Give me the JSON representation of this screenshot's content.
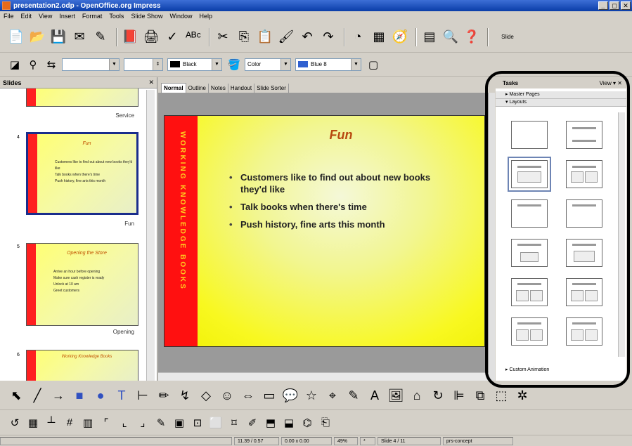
{
  "window": {
    "title": "presentation2.odp - OpenOffice.org Impress"
  },
  "menu": [
    "File",
    "Edit",
    "View",
    "Insert",
    "Format",
    "Tools",
    "Slide Show",
    "Window",
    "Help"
  ],
  "toolbar2": {
    "line_color": "Black",
    "area_style": "Color",
    "area_fill": "Blue 8"
  },
  "toolbar1": {
    "slide_label": "Slide"
  },
  "slides_pane": {
    "title": "Slides",
    "slides": [
      {
        "num": "",
        "name": "Service"
      },
      {
        "num": "4",
        "name": "Fun",
        "title": "Fun",
        "lines": [
          "Customers like to find out about new books they'd like",
          "Talk books when there's time",
          "Push history, fine arts this month"
        ]
      },
      {
        "num": "5",
        "name": "Opening",
        "title": "Opening the Store",
        "lines": [
          "Arrive an hour before opening",
          "Make sure cash register is ready",
          "Unlock at 10 am",
          "Greet customers"
        ]
      },
      {
        "num": "6",
        "name": "",
        "title": "Working Knowledge Books"
      }
    ]
  },
  "view_tabs": [
    "Normal",
    "Outline",
    "Notes",
    "Handout",
    "Slide Sorter"
  ],
  "slide": {
    "title": "Fun",
    "side_text": "WORKING KNOWLEDGE BOOKS",
    "bullets": [
      "Customers like to find out about new books they'd like",
      "Talk books when there's time",
      "Push history, fine arts this month"
    ]
  },
  "tasks_pane": {
    "title": "Tasks",
    "view_label": "View",
    "sections": {
      "master_pages": "Master Pages",
      "layouts": "Layouts",
      "custom_animation": "Custom Animation"
    }
  },
  "status": {
    "position": "11.39 / 0.57",
    "size": "0.00 x 0.00",
    "zoom": "49%",
    "page": "Slide 4 / 11",
    "master": "prs-concept"
  }
}
